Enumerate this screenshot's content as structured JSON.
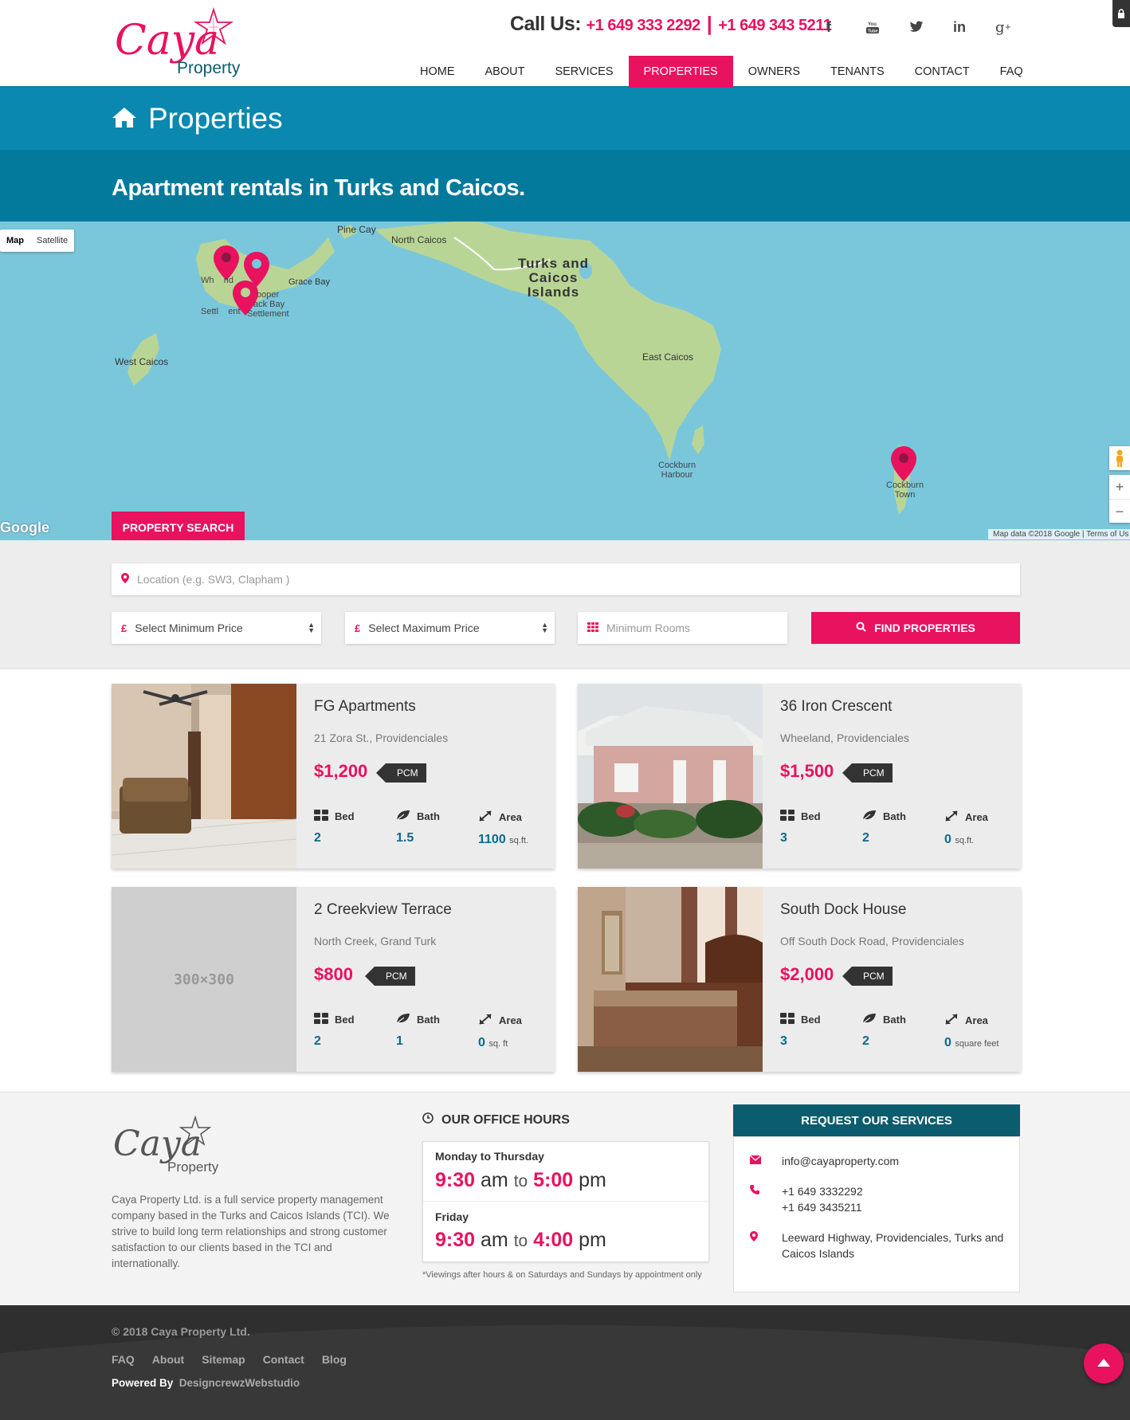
{
  "brand": {
    "logo_script": "Caya",
    "logo_sub": "Property"
  },
  "header": {
    "call_label": "Call Us:",
    "phone1": "+1 649 333 2292",
    "separator": "|",
    "phone2": "+1 649 343 5211",
    "social": [
      "facebook-icon",
      "youtube-icon",
      "twitter-icon",
      "linkedin-icon",
      "google-plus-icon"
    ],
    "nav": [
      {
        "label": "HOME",
        "active": false
      },
      {
        "label": "ABOUT",
        "active": false
      },
      {
        "label": "SERVICES",
        "active": false
      },
      {
        "label": "PROPERTIES",
        "active": true
      },
      {
        "label": "OWNERS",
        "active": false
      },
      {
        "label": "TENANTS",
        "active": false
      },
      {
        "label": "CONTACT",
        "active": false
      },
      {
        "label": "FAQ",
        "active": false
      }
    ]
  },
  "page": {
    "title": "Properties",
    "subtitle": "Apartment rentals in Turks and Caicos."
  },
  "map": {
    "type_map": "Map",
    "type_satellite": "Satellite",
    "labels": {
      "pine_cay": "Pine Cay",
      "north_caicos": "North Caicos",
      "tci_1": "Turks and",
      "tci_2": "Caicos",
      "tci_3": "Islands",
      "wheeland_1": "Wh    nd",
      "wheeland_2": "Settl    ent",
      "cooper_1": "ooper",
      "cooper_2": "ack Bay",
      "cooper_3": "Settlement",
      "grace_bay": "Grace Bay",
      "west_caicos": "West Caicos",
      "east_caicos": "East Caicos",
      "cockburn_harbour_1": "Cockburn",
      "cockburn_harbour_2": "Harbour",
      "cockburn_town_1": "Cockburn",
      "cockburn_town_2": "Town"
    },
    "google": "Google",
    "attribution": "Map data ©2018 Google  |  Terms of Us",
    "zoom_in": "+",
    "zoom_out": "−",
    "colors": {
      "water": "#7ac7db",
      "land": "#b9d596",
      "pin": "#e8125f"
    }
  },
  "search": {
    "tab_label": "PROPERTY SEARCH",
    "location_placeholder": "Location (e.g. SW3, Clapham )",
    "min_price": "Select Minimum Price",
    "max_price": "Select Maximum Price",
    "rooms_placeholder": "Minimum Rooms",
    "currency_symbol": "£",
    "find_label": "FIND PROPERTIES"
  },
  "properties": [
    {
      "name": "FG Apartments",
      "address": "21 Zora St., Providenciales",
      "price": "$1,200",
      "period": "PCM",
      "bed_label": "Bed",
      "bed": "2",
      "bath_label": "Bath",
      "bath": "1.5",
      "area_label": "Area",
      "area": "1100",
      "area_unit": "sq.ft."
    },
    {
      "name": "36 Iron Crescent",
      "address": "Wheeland, Providenciales",
      "price": "$1,500",
      "period": "PCM",
      "bed_label": "Bed",
      "bed": "3",
      "bath_label": "Bath",
      "bath": "2",
      "area_label": "Area",
      "area": "0",
      "area_unit": "sq.ft."
    },
    {
      "name": "2 Creekview Terrace",
      "address": "North Creek, Grand Turk",
      "price": "$800",
      "period": "PCM",
      "bed_label": "Bed",
      "bed": "2",
      "bath_label": "Bath",
      "bath": "1",
      "area_label": "Area",
      "area": "0",
      "area_unit": "sq. ft",
      "placeholder_text": "300×300"
    },
    {
      "name": "South Dock House",
      "address": "Off South Dock Road, Providenciales",
      "price": "$2,000",
      "period": "PCM",
      "bed_label": "Bed",
      "bed": "3",
      "bath_label": "Bath",
      "bath": "2",
      "area_label": "Area",
      "area": "0",
      "area_unit": "square feet"
    }
  ],
  "footer": {
    "about": "Caya Property Ltd. is a full service property management company based in the Turks and Caicos Islands (TCI). We strive to build long term relationships and strong customer satisfaction to our clients based in the TCI and internationally.",
    "hours_title": "OUR OFFICE HOURS",
    "hours": [
      {
        "day": "Monday to Thursday",
        "open": "9:30",
        "open_u": "am",
        "to": "to",
        "close": "5:00",
        "close_u": "pm"
      },
      {
        "day": "Friday",
        "open": "9:30",
        "open_u": "am",
        "to": "to",
        "close": "4:00",
        "close_u": "pm"
      }
    ],
    "hours_note": "*Viewings after hours & on Saturdays and Sundays by appointment only",
    "request_title": "REQUEST OUR SERVICES",
    "email": "info@cayaproperty.com",
    "phone1": "+1 649 3332292",
    "phone2": "+1 649 3435211",
    "address": "Leeward Highway, Providenciales, Turks and Caicos Islands",
    "copyright": "© 2018 Caya Property Ltd.",
    "links": [
      "FAQ",
      "About",
      "Sitemap",
      "Contact",
      "Blog"
    ],
    "powered_label": "Powered By",
    "powered_by": "DesigncrewzWebstudio"
  }
}
